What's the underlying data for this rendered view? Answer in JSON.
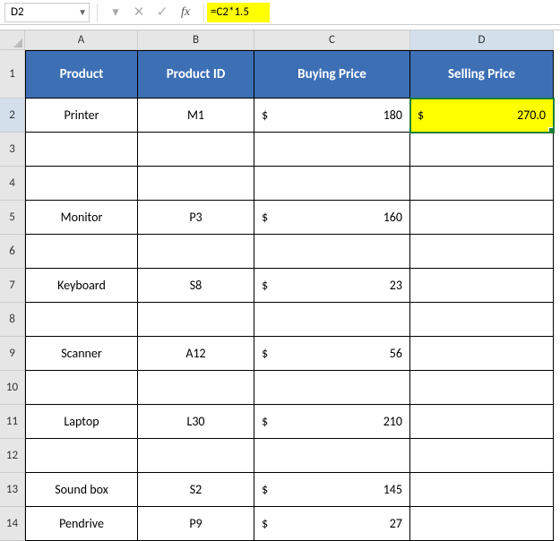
{
  "name_box": "D2",
  "formula": "=C2*1.5",
  "columns": [
    "A",
    "B",
    "C",
    "D"
  ],
  "active_col": "D",
  "active_row": "2",
  "headers": {
    "A": "Product",
    "B": "Product ID",
    "C": "Buying Price",
    "D": "Selling Price"
  },
  "rows": [
    {
      "n": "2",
      "A": "Printer",
      "B": "M1",
      "C_sym": "$",
      "C_val": "180",
      "D_sym": "$",
      "D_val": "270.0",
      "selected": true
    },
    {
      "n": "3",
      "A": "",
      "B": "",
      "C_sym": "",
      "C_val": "",
      "D_sym": "",
      "D_val": ""
    },
    {
      "n": "4",
      "A": "",
      "B": "",
      "C_sym": "",
      "C_val": "",
      "D_sym": "",
      "D_val": ""
    },
    {
      "n": "5",
      "A": "Monitor",
      "B": "P3",
      "C_sym": "$",
      "C_val": "160",
      "D_sym": "",
      "D_val": ""
    },
    {
      "n": "6",
      "A": "",
      "B": "",
      "C_sym": "",
      "C_val": "",
      "D_sym": "",
      "D_val": ""
    },
    {
      "n": "7",
      "A": "Keyboard",
      "B": "S8",
      "C_sym": "$",
      "C_val": "23",
      "D_sym": "",
      "D_val": ""
    },
    {
      "n": "8",
      "A": "",
      "B": "",
      "C_sym": "",
      "C_val": "",
      "D_sym": "",
      "D_val": ""
    },
    {
      "n": "9",
      "A": "Scanner",
      "B": "A12",
      "C_sym": "$",
      "C_val": "56",
      "D_sym": "",
      "D_val": ""
    },
    {
      "n": "10",
      "A": "",
      "B": "",
      "C_sym": "",
      "C_val": "",
      "D_sym": "",
      "D_val": ""
    },
    {
      "n": "11",
      "A": "Laptop",
      "B": "L30",
      "C_sym": "$",
      "C_val": "210",
      "D_sym": "",
      "D_val": ""
    },
    {
      "n": "12",
      "A": "",
      "B": "",
      "C_sym": "",
      "C_val": "",
      "D_sym": "",
      "D_val": ""
    },
    {
      "n": "13",
      "A": "Sound box",
      "B": "S2",
      "C_sym": "$",
      "C_val": "145",
      "D_sym": "",
      "D_val": ""
    },
    {
      "n": "14",
      "A": "Pendrive",
      "B": "P9",
      "C_sym": "$",
      "C_val": "27",
      "D_sym": "",
      "D_val": ""
    }
  ]
}
